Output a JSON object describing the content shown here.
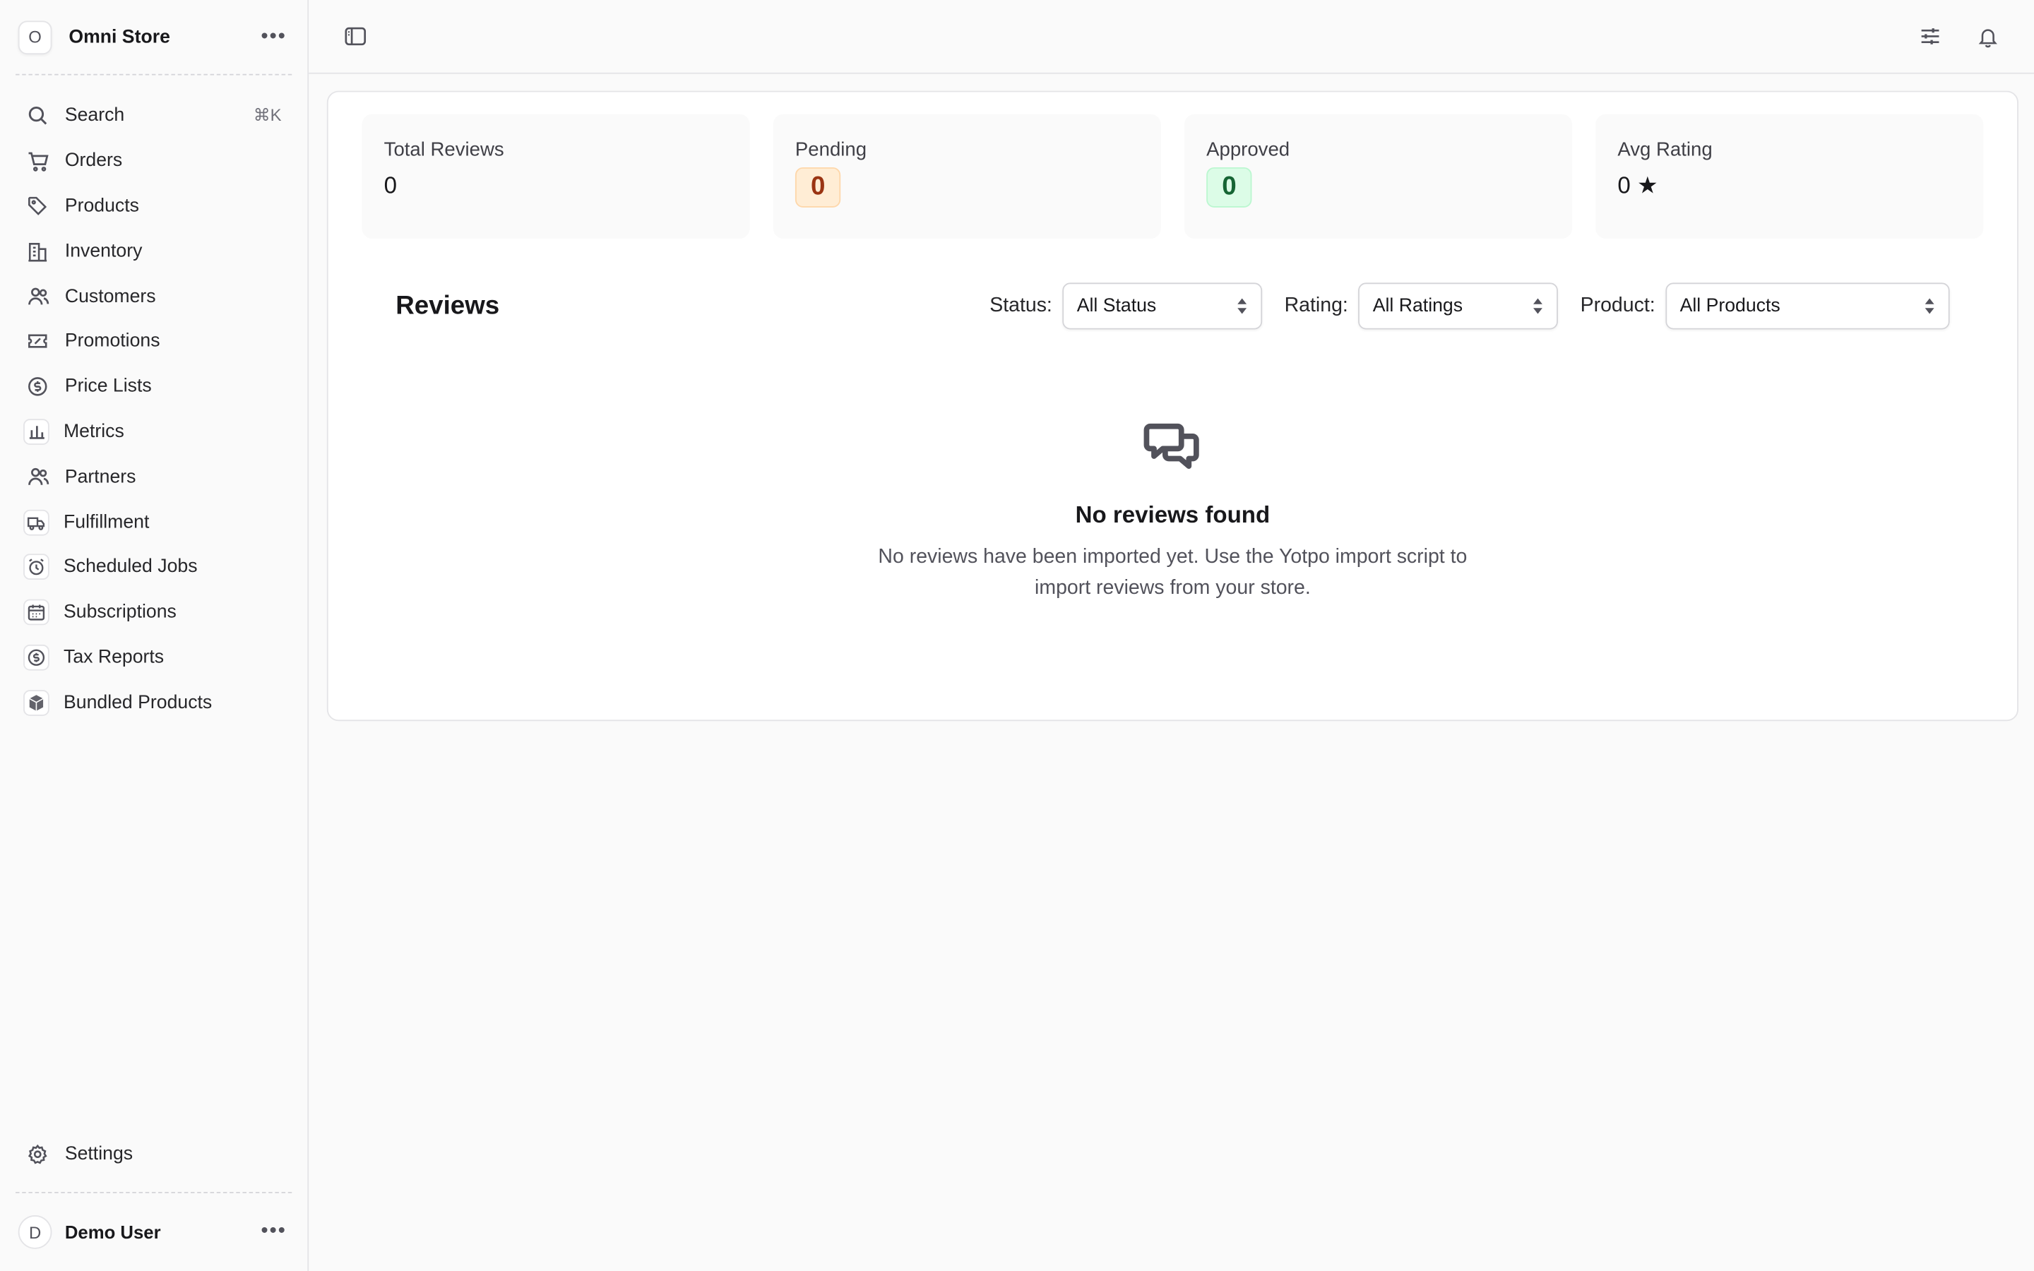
{
  "store": {
    "initial": "O",
    "name": "Omni Store"
  },
  "sidebar": {
    "search": {
      "label": "Search",
      "shortcut": "⌘K"
    },
    "items": [
      {
        "label": "Orders",
        "icon": "cart-icon"
      },
      {
        "label": "Products",
        "icon": "tag-icon"
      },
      {
        "label": "Inventory",
        "icon": "building-icon"
      },
      {
        "label": "Customers",
        "icon": "users-icon"
      },
      {
        "label": "Promotions",
        "icon": "ticket-icon"
      },
      {
        "label": "Price Lists",
        "icon": "dollar-circle-icon"
      },
      {
        "label": "Metrics",
        "icon": "bar-chart-icon"
      },
      {
        "label": "Partners",
        "icon": "users-icon"
      },
      {
        "label": "Fulfillment",
        "icon": "truck-icon"
      },
      {
        "label": "Scheduled Jobs",
        "icon": "alarm-clock-icon"
      },
      {
        "label": "Subscriptions",
        "icon": "calendar-icon"
      },
      {
        "label": "Tax Reports",
        "icon": "dollar-circle-icon"
      },
      {
        "label": "Bundled Products",
        "icon": "cube-icon"
      }
    ],
    "settings": {
      "label": "Settings"
    }
  },
  "user": {
    "initial": "D",
    "name": "Demo User"
  },
  "stats": {
    "total": {
      "label": "Total Reviews",
      "value": "0"
    },
    "pending": {
      "label": "Pending",
      "value": "0"
    },
    "approved": {
      "label": "Approved",
      "value": "0"
    },
    "avg": {
      "label": "Avg Rating",
      "value": "0 ★"
    }
  },
  "reviews": {
    "title": "Reviews",
    "filters": {
      "status": {
        "label": "Status:",
        "value": "All Status"
      },
      "rating": {
        "label": "Rating:",
        "value": "All Ratings"
      },
      "product": {
        "label": "Product:",
        "value": "All Products"
      }
    },
    "empty": {
      "title": "No reviews found",
      "line1": "No reviews have been imported yet. Use the Yotpo import script to",
      "line2": "import reviews from your store."
    }
  },
  "colors": {
    "pending_bg": "#ffedd5",
    "pending_fg": "#9a3412",
    "approved_bg": "#dcfce7",
    "approved_fg": "#166534"
  }
}
